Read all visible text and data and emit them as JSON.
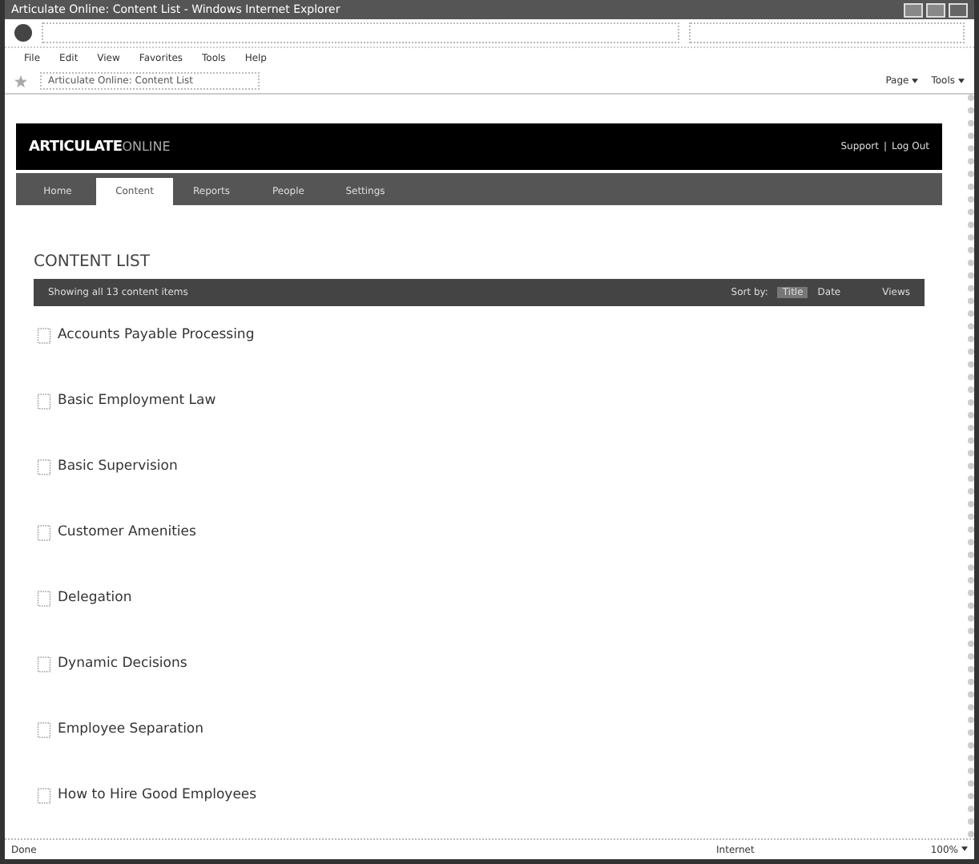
{
  "window": {
    "title": "Articulate Online: Content List - Windows Internet Explorer"
  },
  "menu": [
    {
      "label": "File"
    },
    {
      "label": "Edit"
    },
    {
      "label": "View"
    },
    {
      "label": "Favorites"
    },
    {
      "label": "Tools"
    },
    {
      "label": "Help"
    }
  ],
  "tab": {
    "title": "Articulate Online: Content List"
  },
  "command_bar": [
    {
      "label": "Page"
    },
    {
      "label": "Tools"
    }
  ],
  "site": {
    "logo_bold": "ARTICULATE",
    "logo_light": "ONLINE",
    "separator": "|",
    "links": [
      {
        "label": "Support"
      },
      {
        "label": "Log Out"
      }
    ]
  },
  "nav": [
    {
      "label": "Home",
      "selected": false
    },
    {
      "label": "Content",
      "selected": true
    },
    {
      "label": "Reports",
      "selected": false
    },
    {
      "label": "People",
      "selected": false
    },
    {
      "label": "Settings",
      "selected": false
    }
  ],
  "heading": "CONTENT LIST",
  "list_bar": {
    "summary": "Showing all 13 content items",
    "sort_label": "Sort by:",
    "sort_options": [
      {
        "label": "Title",
        "selected": true
      },
      {
        "label": "Date",
        "selected": false
      }
    ],
    "views": "Views"
  },
  "items": [
    {
      "title": "Accounts Payable Processing"
    },
    {
      "title": "Basic Employment Law"
    },
    {
      "title": "Basic Supervision"
    },
    {
      "title": "Customer Amenities"
    },
    {
      "title": "Delegation"
    },
    {
      "title": "Dynamic Decisions"
    },
    {
      "title": "Employee Separation"
    },
    {
      "title": "How to Hire Good Employees"
    }
  ],
  "status_bar": {
    "text": "Done",
    "zone": "Internet",
    "zoom": "100%"
  }
}
